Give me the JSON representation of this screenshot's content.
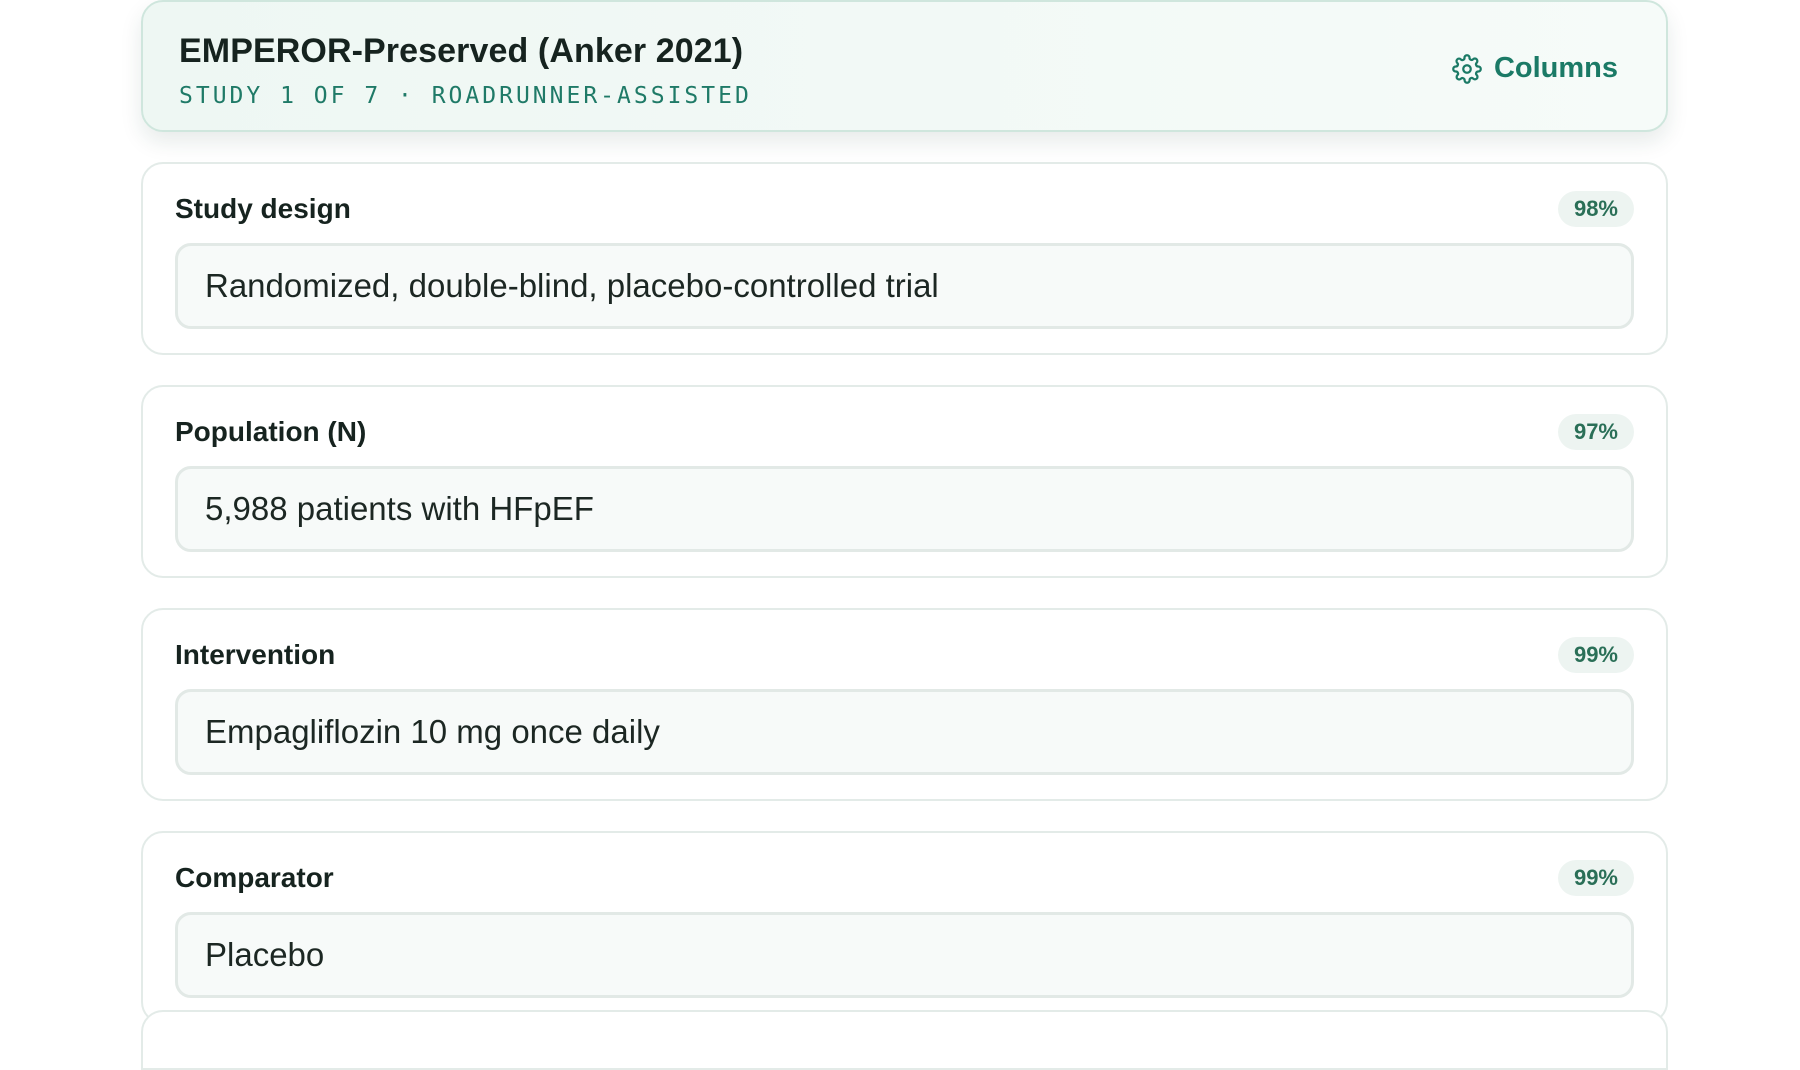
{
  "header": {
    "title": "EMPEROR-Preserved (Anker 2021)",
    "subtitle": "STUDY 1 OF 7 · ROADRUNNER-ASSISTED",
    "columns_label": "Columns"
  },
  "fields": [
    {
      "label": "Study design",
      "confidence": "98%",
      "value": "Randomized, double-blind, placebo-controlled trial"
    },
    {
      "label": "Population (N)",
      "confidence": "97%",
      "value": "5,988 patients with HFpEF"
    },
    {
      "label": "Intervention",
      "confidence": "99%",
      "value": "Empagliflozin 10 mg once daily"
    },
    {
      "label": "Comparator",
      "confidence": "99%",
      "value": "Placebo"
    }
  ],
  "icons": {
    "columns": "gear-icon"
  },
  "colors": {
    "accent": "#1b7a66",
    "header_bg": "#eef7f3",
    "badge_bg": "#edf4f1",
    "badge_text": "#2a6f57"
  }
}
